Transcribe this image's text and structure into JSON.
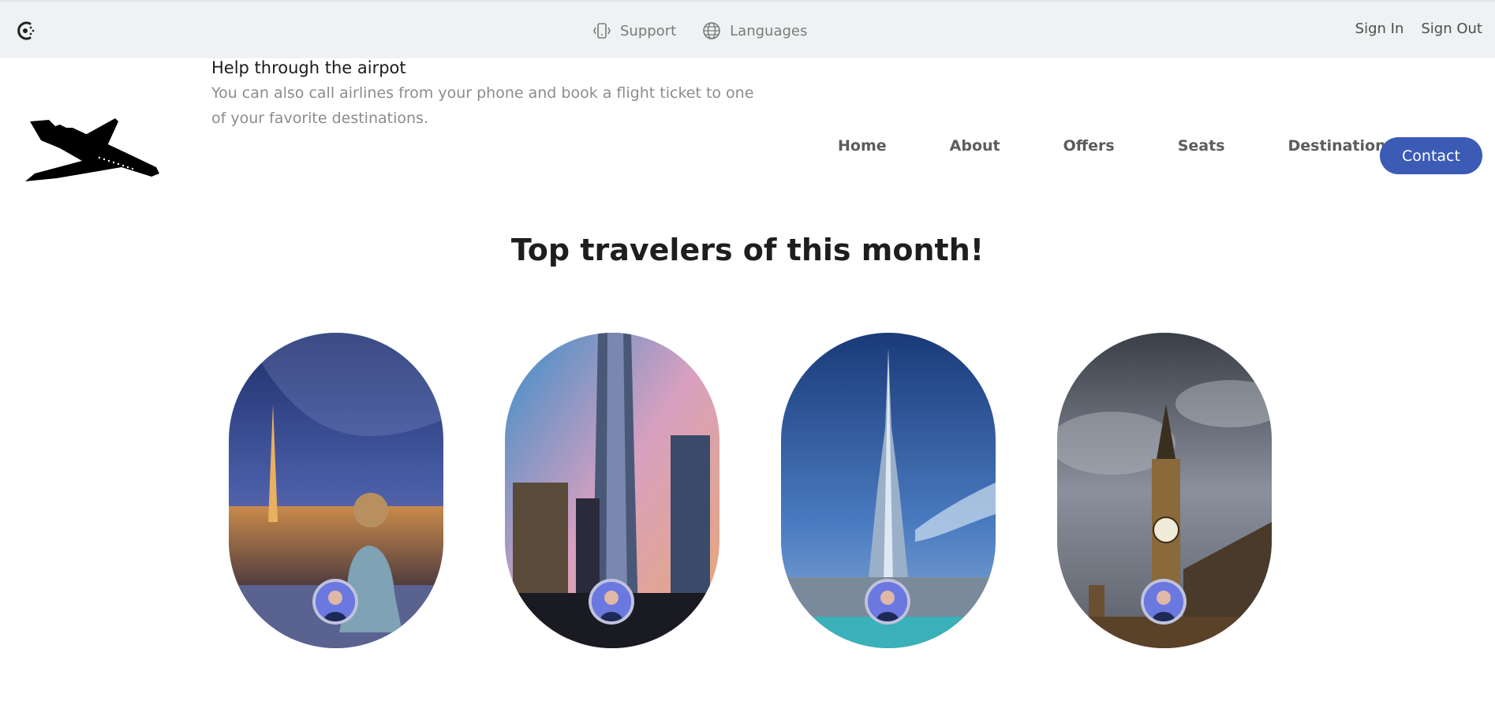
{
  "topbar": {
    "logo_icon": "brand-spinner-icon",
    "links": [
      {
        "label": "Support",
        "icon": "phone-vibrate-icon"
      },
      {
        "label": "Languages",
        "icon": "globe-icon"
      }
    ],
    "sign_in": "Sign In",
    "sign_out": "Sign Out"
  },
  "brand": {
    "logo_icon": "airplane-icon"
  },
  "help": {
    "title": "Help through the airpot",
    "description": "You can also call airlines from your phone and book a flight ticket to one of your favorite destinations."
  },
  "nav": {
    "items": [
      "Home",
      "About",
      "Offers",
      "Seats",
      "Destinations"
    ],
    "contact": "Contact"
  },
  "colors": {
    "accent": "#3b5bb5",
    "topbar_bg": "#eff2f3"
  },
  "section": {
    "title": "Top travelers of this month!"
  },
  "travelers": [
    {
      "scene": "paris-eiffel-night",
      "avatar_icon": "user-avatar"
    },
    {
      "scene": "new-york-skyscrapers",
      "avatar_icon": "user-avatar"
    },
    {
      "scene": "dubai-burj-khalifa",
      "avatar_icon": "user-avatar"
    },
    {
      "scene": "london-big-ben",
      "avatar_icon": "user-avatar"
    }
  ]
}
